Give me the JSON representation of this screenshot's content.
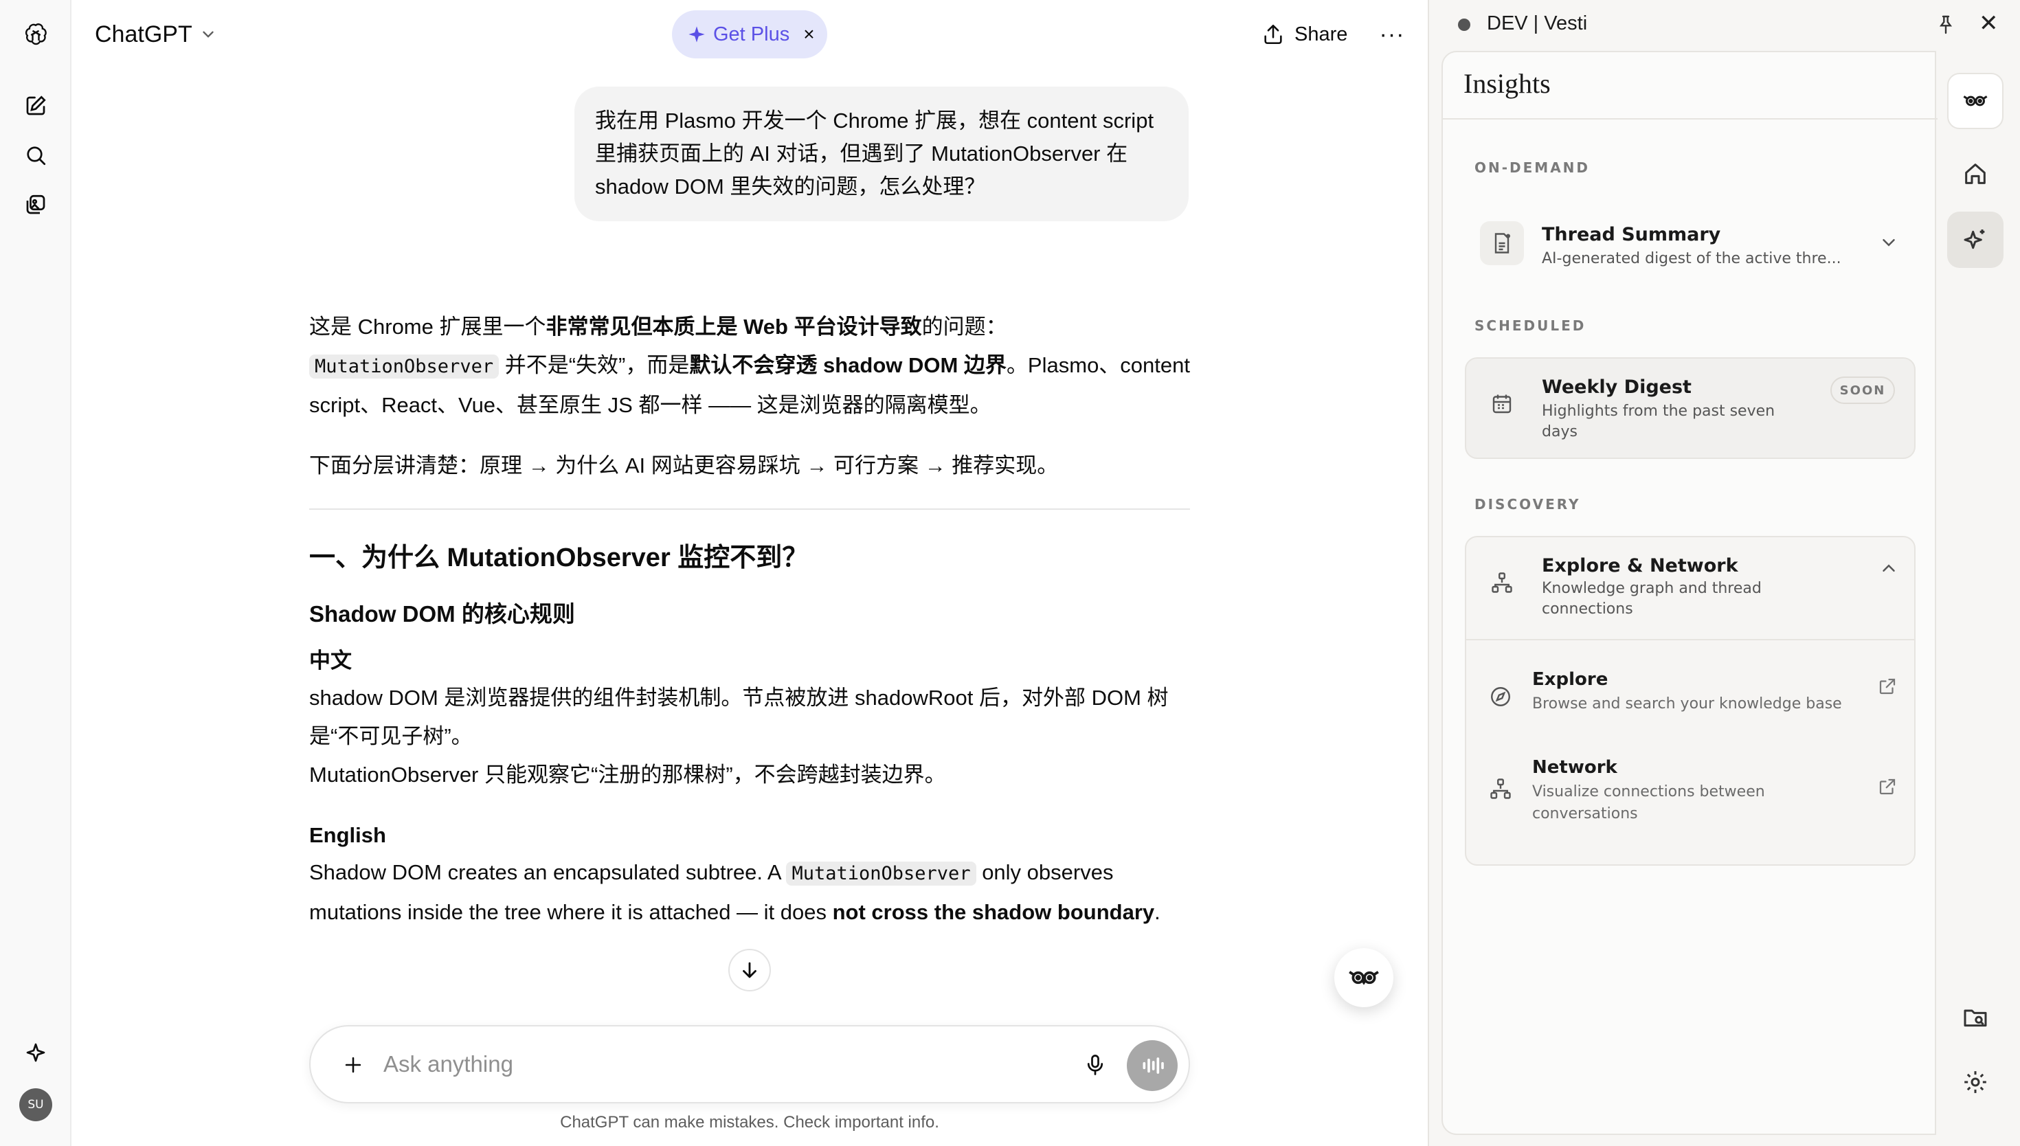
{
  "header": {
    "model_name": "ChatGPT",
    "get_plus_label": "Get Plus",
    "get_plus_close": "×",
    "share_label": "Share",
    "more_label": "···"
  },
  "sidebar": {
    "avatar_initials": "SU",
    "icons": [
      "openai-logo-icon",
      "new-chat-icon",
      "search-icon",
      "library-icon",
      "sparkle-icon"
    ]
  },
  "chat": {
    "user_message": "我在用 Plasmo 开发一个 Chrome 扩展，想在 content script 里捕获页面上的 AI 对话，但遇到了 MutationObserver 在 shadow DOM 里失效的问题，怎么处理？",
    "answer": {
      "p1_a": "这是 Chrome 扩展里一个",
      "p1_b": "非常常见但本质上是 Web 平台设计导致",
      "p1_c": "的问题：",
      "p1_code": "MutationObserver",
      "p1_d": " 并不是“失效”，而是",
      "p1_e": "默认不会穿透 shadow DOM 边界",
      "p1_f": "。Plasmo、content script、React、Vue、甚至原生 JS 都一样 —— 这是浏览器的隔离模型。",
      "p2": "下面分层讲清楚：原理 → 为什么 AI 网站更容易踩坑 → 可行方案 → 推荐实现。",
      "h2": "一、为什么 MutationObserver 监控不到？",
      "h3": "Shadow DOM 的核心规则",
      "zh_label": "中文",
      "zh_line1": "shadow DOM 是浏览器提供的组件封装机制。节点被放进 shadowRoot 后，对外部 DOM 树是“不可见子树”。",
      "zh_line2": "MutationObserver 只能观察它“注册的那棵树”，不会跨越封装边界。",
      "en_label": "English",
      "en_a": "Shadow DOM creates an encapsulated subtree. A ",
      "en_code": "MutationObserver",
      "en_b": " only observes mutations inside the tree where it is attached — it does ",
      "en_bold": "not cross the shadow boundary",
      "en_c": "."
    }
  },
  "composer": {
    "placeholder": "Ask anything",
    "disclaimer": "ChatGPT can make mistakes. Check important info."
  },
  "panel": {
    "window_title": "DEV | Vesti",
    "heading": "Insights",
    "sections": {
      "on_demand": "ON-DEMAND",
      "scheduled": "SCHEDULED",
      "discovery": "DISCOVERY"
    },
    "thread_summary": {
      "title": "Thread Summary",
      "subtitle": "AI-generated digest of the active thre..."
    },
    "weekly_digest": {
      "title": "Weekly Digest",
      "subtitle_line1": "Highlights from the past seven",
      "subtitle_line2": "days",
      "badge": "SOON"
    },
    "explore_network": {
      "title": "Explore & Network",
      "subtitle_line1": "Knowledge graph and thread",
      "subtitle_line2": "connections",
      "items": [
        {
          "title": "Explore",
          "subtitle_line1": "Browse and search your knowledge base",
          "subtitle_line2": ""
        },
        {
          "title": "Network",
          "subtitle_line1": "Visualize connections between",
          "subtitle_line2": "conversations"
        }
      ]
    }
  }
}
